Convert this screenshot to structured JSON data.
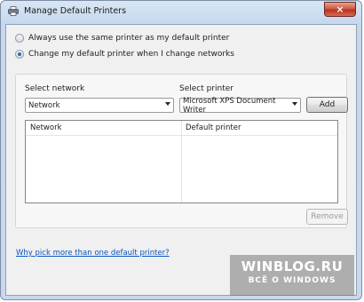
{
  "window": {
    "title": "Manage Default Printers",
    "close_glyph": "×"
  },
  "options": [
    {
      "label": "Always use the same printer as my default printer",
      "checked": false
    },
    {
      "label": "Change my default printer when I change networks",
      "checked": true
    }
  ],
  "form": {
    "network_label": "Select network",
    "network_value": "Network",
    "printer_label": "Select printer",
    "printer_value": "Microsoft XPS Document Writer",
    "add_label": "Add"
  },
  "table": {
    "columns": [
      "Network",
      "Default printer"
    ],
    "rows": []
  },
  "remove_label": "Remove",
  "help_link": "Why pick more than one default printer?",
  "watermark": {
    "title": "WINBLOG.RU",
    "subtitle": "ВСЁ О WINDOWS"
  }
}
